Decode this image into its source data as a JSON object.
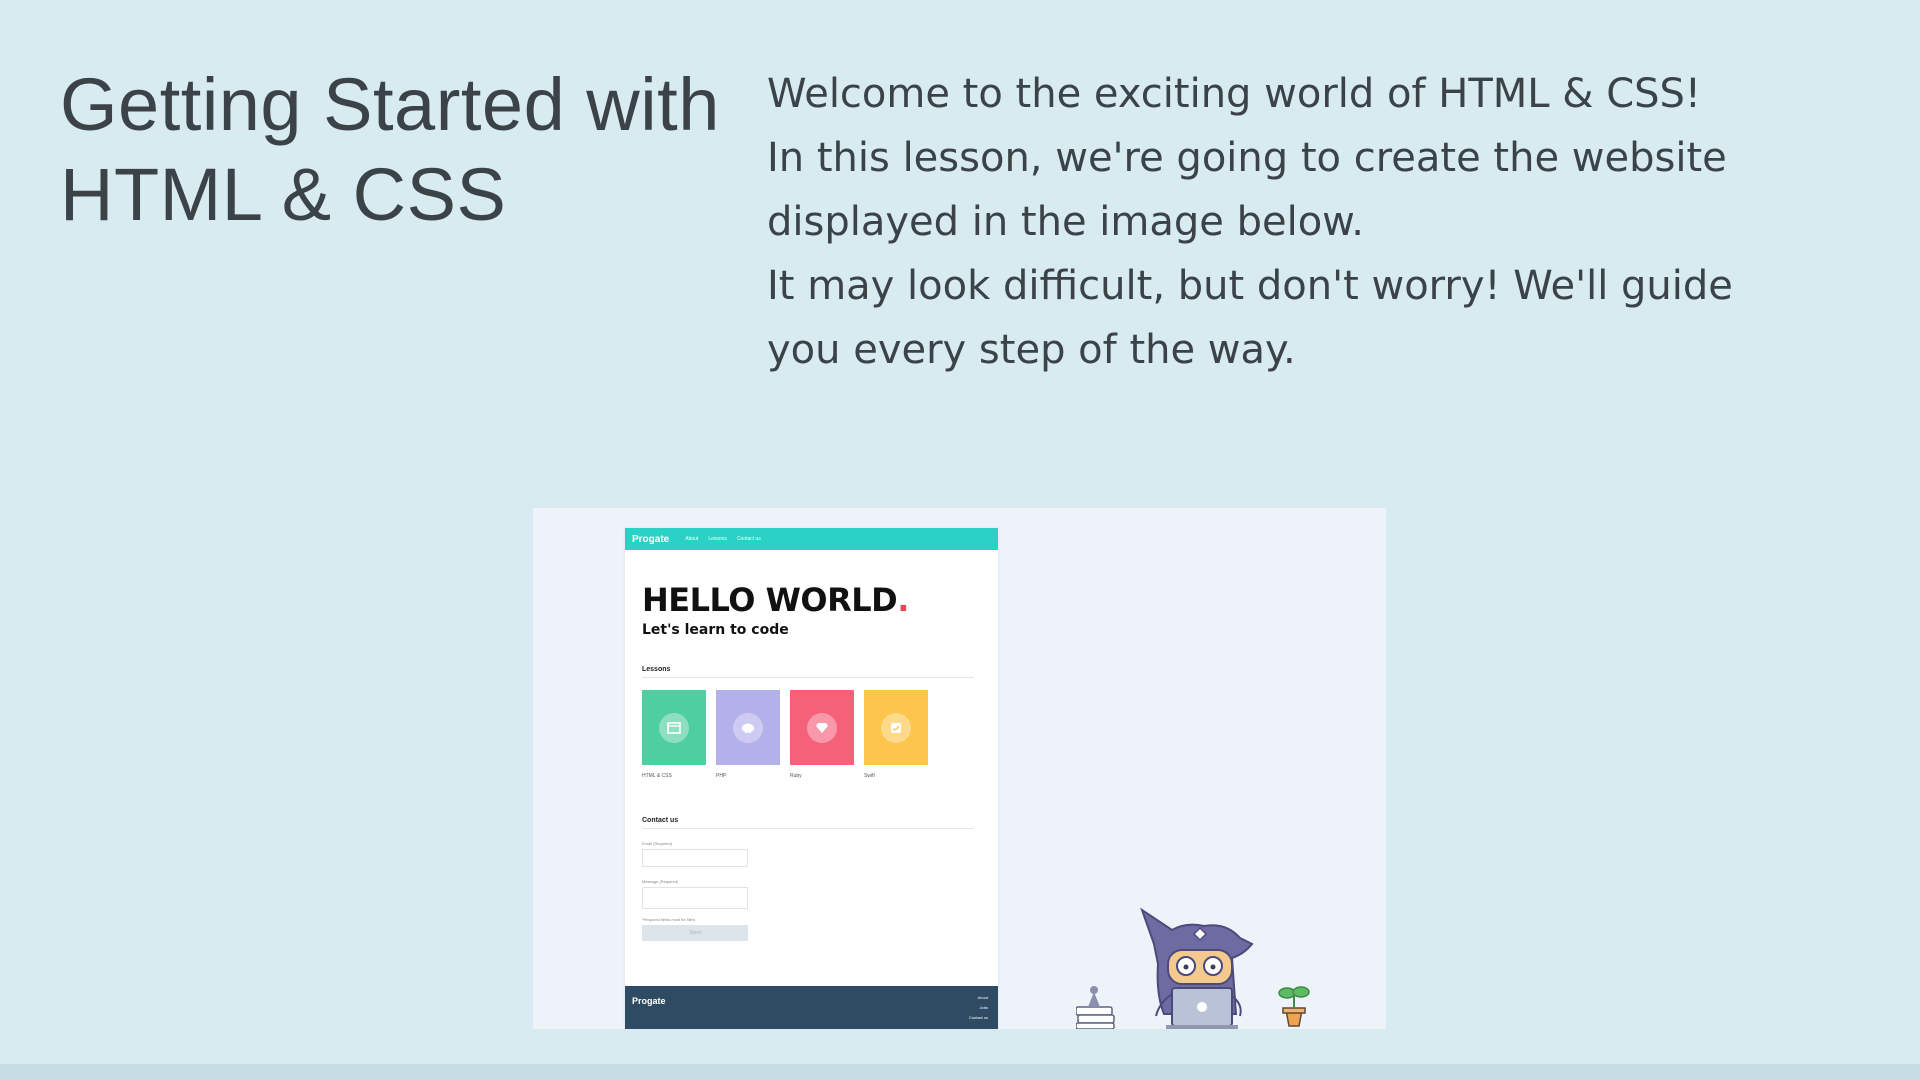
{
  "slide": {
    "title": "Getting Started with HTML & CSS",
    "intro": [
      "Welcome to the exciting world of HTML & CSS!",
      "In this lesson, we're going to create the website displayed in the image below.",
      "It may look difficult, but don't worry! We'll guide you every step of the way."
    ]
  },
  "preview": {
    "header": {
      "logo": "Progate",
      "nav": [
        "About",
        "Lessons",
        "Contact us"
      ]
    },
    "hero": {
      "heading": "HELLO WORLD",
      "heading_dot": ".",
      "tagline": "Let's learn to code"
    },
    "lessons": {
      "label": "Lessons",
      "cards": [
        {
          "label": "HTML & CSS",
          "color": "#4fcf9f",
          "icon": "window-icon"
        },
        {
          "label": "PHP",
          "color": "#b3b0ea",
          "icon": "elephant-icon"
        },
        {
          "label": "Ruby",
          "color": "#f6617a",
          "icon": "gem-icon"
        },
        {
          "label": "Swift",
          "color": "#fbc54e",
          "icon": "bird-icon"
        }
      ]
    },
    "contact": {
      "label": "Contact us",
      "email_label": "Email (Required)",
      "message_label": "Message (Required)",
      "note": "*Required fields must be filled",
      "send_label": "Send"
    },
    "footer": {
      "logo": "Progate",
      "links": [
        "About",
        "Jobs",
        "Contact us"
      ]
    }
  },
  "colors": {
    "background": "#d7ebf0",
    "header": "#2bd1c4",
    "footer": "#2e4b63",
    "accent_dot": "#e74a57"
  }
}
